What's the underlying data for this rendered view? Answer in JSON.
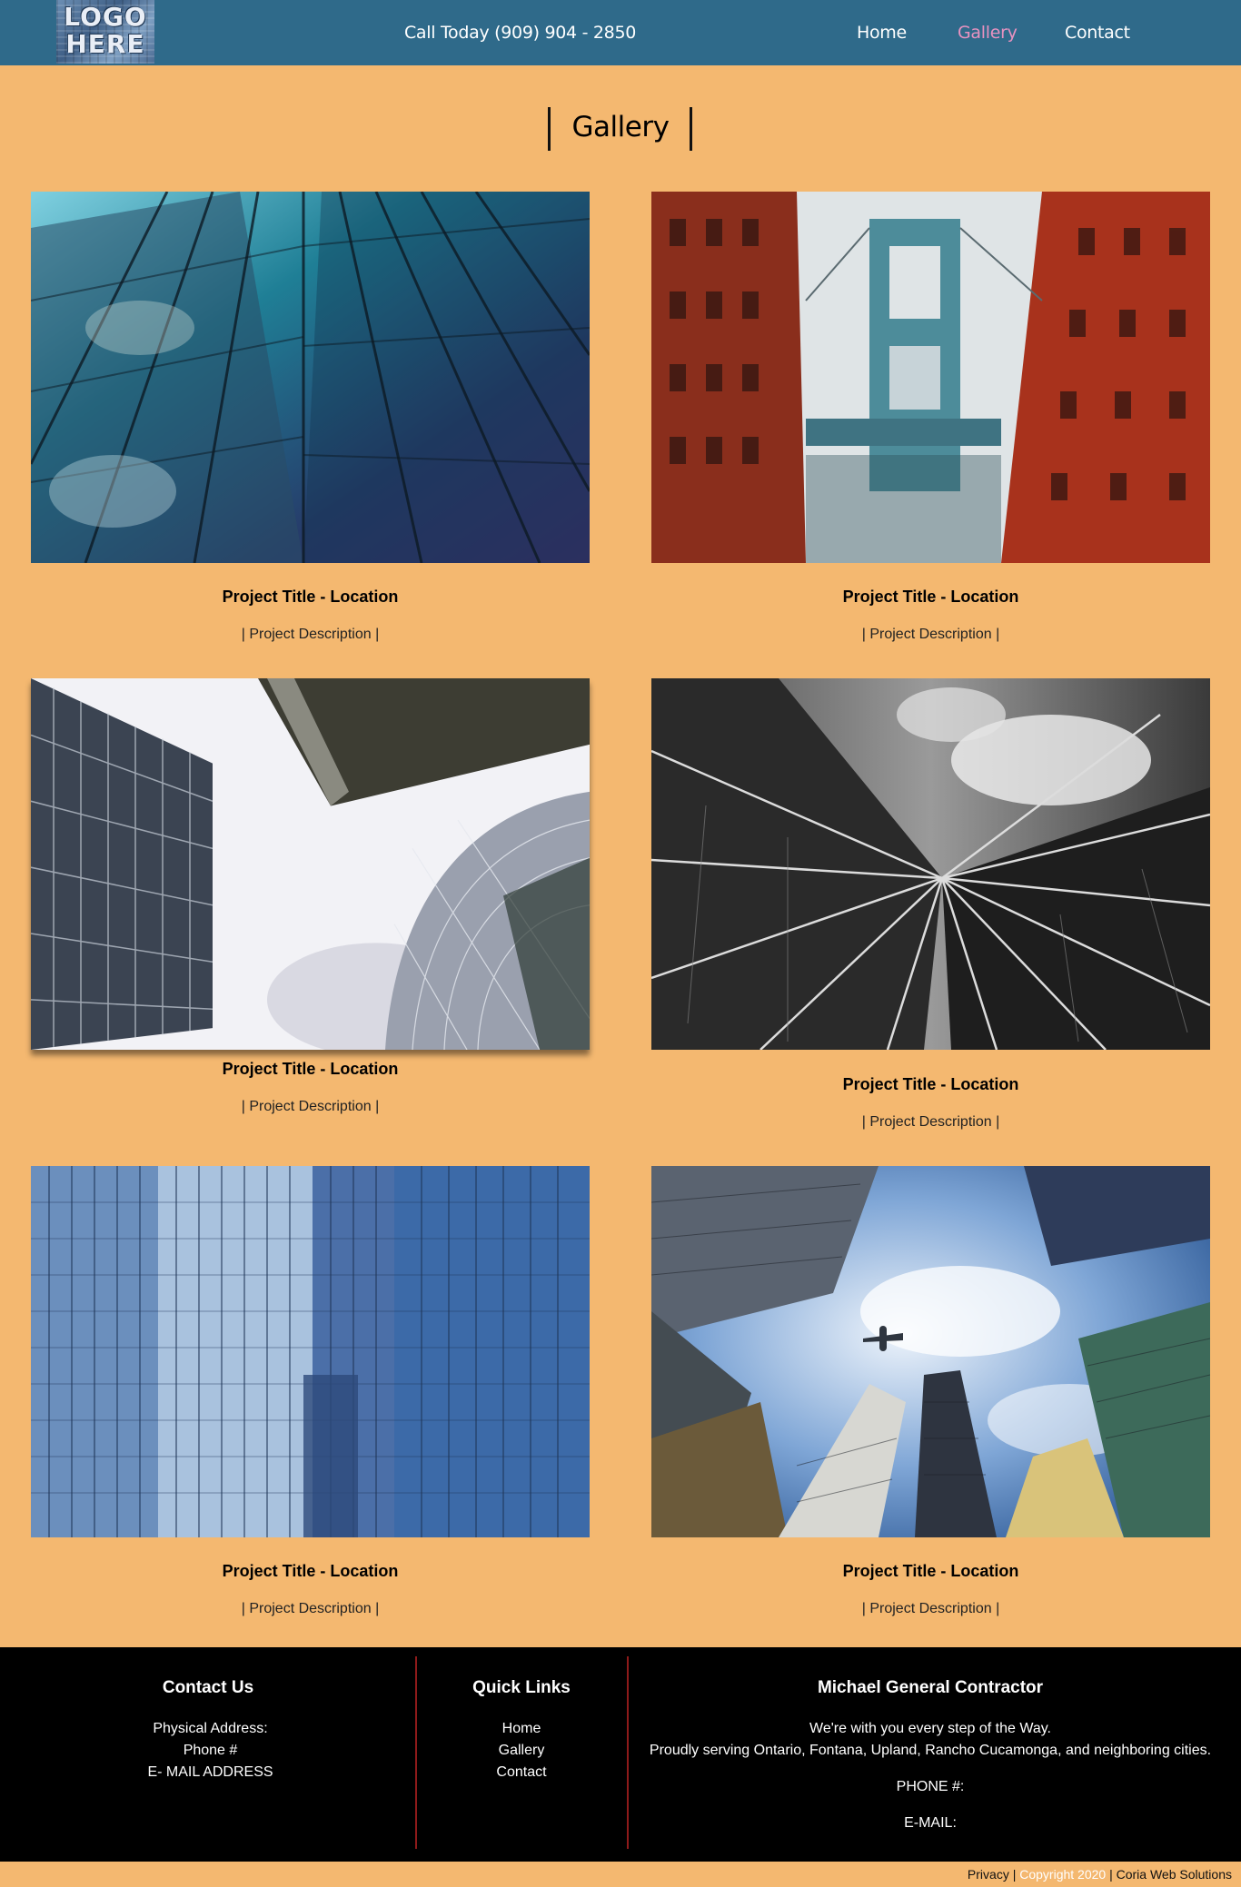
{
  "header": {
    "logo_line1": "LOGO",
    "logo_line2": "HERE",
    "phone": "Call Today (909) 904 - 2850",
    "nav": [
      "Home",
      "Gallery",
      "Contact"
    ],
    "active_nav": "Gallery",
    "bg_color": "#2f6a8a",
    "active_color": "#e892c0"
  },
  "page": {
    "title": "Gallery",
    "bg_color": "#f4b870"
  },
  "gallery": [
    {
      "title": "Project Title - Location",
      "description": "| Project Description |",
      "image": "glass-skyscraper-teal-photo"
    },
    {
      "title": "Project Title - Location",
      "description": "| Project Description |",
      "image": "manhattan-bridge-brick-buildings-photo"
    },
    {
      "title": "Project Title - Location",
      "description": "| Project Description |",
      "image": "office-towers-white-sky-photo"
    },
    {
      "title": "Project Title - Location",
      "description": "| Project Description |",
      "image": "black-white-glass-tower-photo"
    },
    {
      "title": "Project Title - Location",
      "description": "| Project Description |",
      "image": "blue-glass-office-buildings-photo"
    },
    {
      "title": "Project Title - Location",
      "description": "| Project Description |",
      "image": "skyscrapers-sky-airplane-photo"
    }
  ],
  "footer": {
    "contact": {
      "heading": "Contact Us",
      "address": "Physical Address:",
      "phone": "Phone #",
      "email": "E- MAIL ADDRESS"
    },
    "quick_links": {
      "heading": "Quick Links",
      "links": [
        "Home",
        "Gallery",
        "Contact"
      ]
    },
    "company": {
      "heading": "Michael General Contractor",
      "tagline": "We're with you every step of the Way.",
      "service_area": "Proudly serving Ontario, Fontana, Upland, Rancho Cucamonga, and neighboring cities.",
      "phone_label": "PHONE #:",
      "email_label": "E-MAIL:"
    },
    "bottom": {
      "privacy": "Privacy",
      "sep1": " | ",
      "copyright": "Copyright 2020",
      "sep2": " | ",
      "credit": "Coria Web Solutions"
    }
  }
}
